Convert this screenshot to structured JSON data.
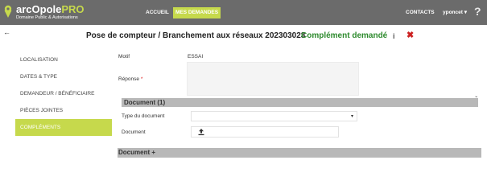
{
  "app": {
    "name": "arcOpole",
    "name_suffix": "PRO",
    "tagline": "Domaine Public & Autorisations"
  },
  "nav": {
    "accueil": "ACCUEIL",
    "mes_demandes": "MES DEMANDES",
    "contacts": "CONTACTS",
    "user": "yponcet ▾",
    "help_glyph": "?"
  },
  "header": {
    "back_glyph": "←",
    "title": "Pose de compteur / Branchement aux réseaux 202303023",
    "status": "Complément demandé",
    "info_glyph": "i",
    "close_glyph": "✖"
  },
  "sidebar": {
    "items": [
      {
        "label": "LOCALISATION"
      },
      {
        "label": "DATES & TYPE"
      },
      {
        "label": "DEMANDEUR / BÉNÉFICIAIRE"
      },
      {
        "label": "PIÈCES JOINTES"
      },
      {
        "label": "COMPLÉMENTS"
      }
    ]
  },
  "form": {
    "motif_label": "Motif",
    "motif_value": "ESSAI",
    "reponse_label": "Réponse",
    "required_mark": "*",
    "reponse_value": ""
  },
  "document_section": {
    "title": "Document (1)",
    "chevron_glyph": "ˇ",
    "type_label": "Type du document",
    "type_value": "",
    "caret_glyph": "▾",
    "document_label": "Document"
  },
  "add_document": {
    "label": "Document",
    "plus_glyph": "+"
  },
  "colors": {
    "topbar": "#6b6b6b",
    "accent": "#c6d94c",
    "status": "#2d8a2d",
    "close": "#cc2222",
    "section_bar": "#b8b8b8"
  },
  "icons": {
    "logo": "arcopole-logo-icon",
    "help": "help-icon",
    "back": "back-arrow-icon",
    "info": "info-icon",
    "close": "close-icon",
    "chevron": "chevron-down-icon",
    "caret": "caret-down-icon",
    "upload": "upload-icon",
    "plus": "plus-icon"
  }
}
